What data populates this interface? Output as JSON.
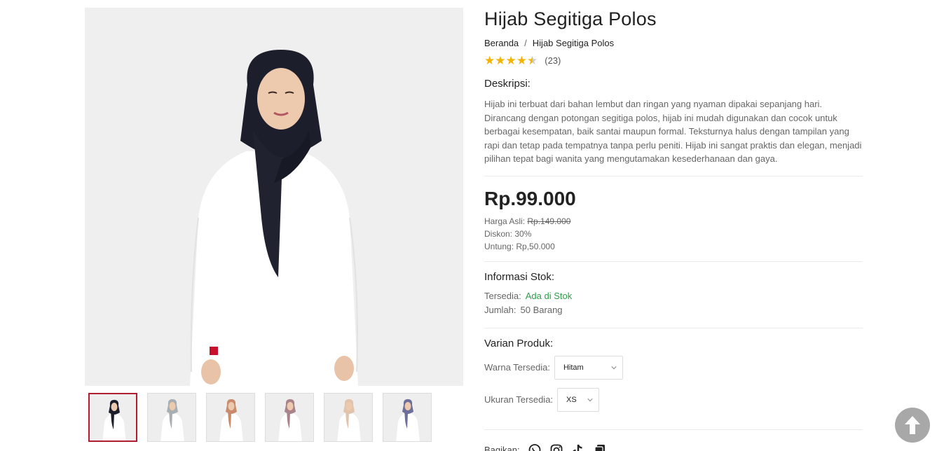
{
  "product": {
    "title": "Hijab Segitiga Polos",
    "breadcrumb": [
      "Beranda",
      "/",
      "Hijab Segitiga Polos"
    ],
    "rating": {
      "value": 4.5,
      "max": 5,
      "count": "(23)"
    },
    "description_label": "Deskripsi:",
    "description": "Hijab ini terbuat dari bahan lembut dan ringan yang nyaman dipakai sepanjang hari. Dirancang dengan potongan segitiga polos, hijab ini mudah digunakan dan cocok untuk berbagai kesempatan, baik santai maupun formal. Teksturnya halus dengan tampilan yang rapi dan tetap pada tempatnya tanpa perlu peniti. Hijab ini sangat praktis dan elegan, menjadi pilihan tepat bagi wanita yang mengutamakan kesederhanaan dan gaya."
  },
  "pricing": {
    "price": "Rp.99.000",
    "original_label": "Harga Asli: ",
    "original_price": "Rp.149.000",
    "discount": "Diskon: 30%",
    "profit": "Untung: Rp,50.000"
  },
  "stock": {
    "label": "Informasi Stok:",
    "available_label": "Tersedia:",
    "available_value": "Ada di Stok",
    "quantity_label": "Jumlah:",
    "quantity_value": "50 Barang"
  },
  "variants": {
    "label": "Varian Produk:",
    "color_label": "Warna Tersedia:",
    "color_value": "Hitam",
    "size_label": "Ukuran Tersedia:",
    "size_value": "XS"
  },
  "share": {
    "label": "Bagikan:",
    "icons": [
      "whatsapp-icon",
      "instagram-icon",
      "tiktok-icon",
      "copy-link-icon"
    ]
  },
  "gallery": {
    "thumbnail_hijab_colors": [
      "#1c1f2b",
      "#a9aeb1",
      "#c98b6c",
      "#a9838a",
      "#e2c3ac",
      "#6c6f9a"
    ],
    "active_index": 0
  },
  "colors": {
    "accent_border": "#b01e2f",
    "star": "#f5b301",
    "in_stock": "#2e9f49",
    "scroll_button": "#a8a8a8"
  }
}
